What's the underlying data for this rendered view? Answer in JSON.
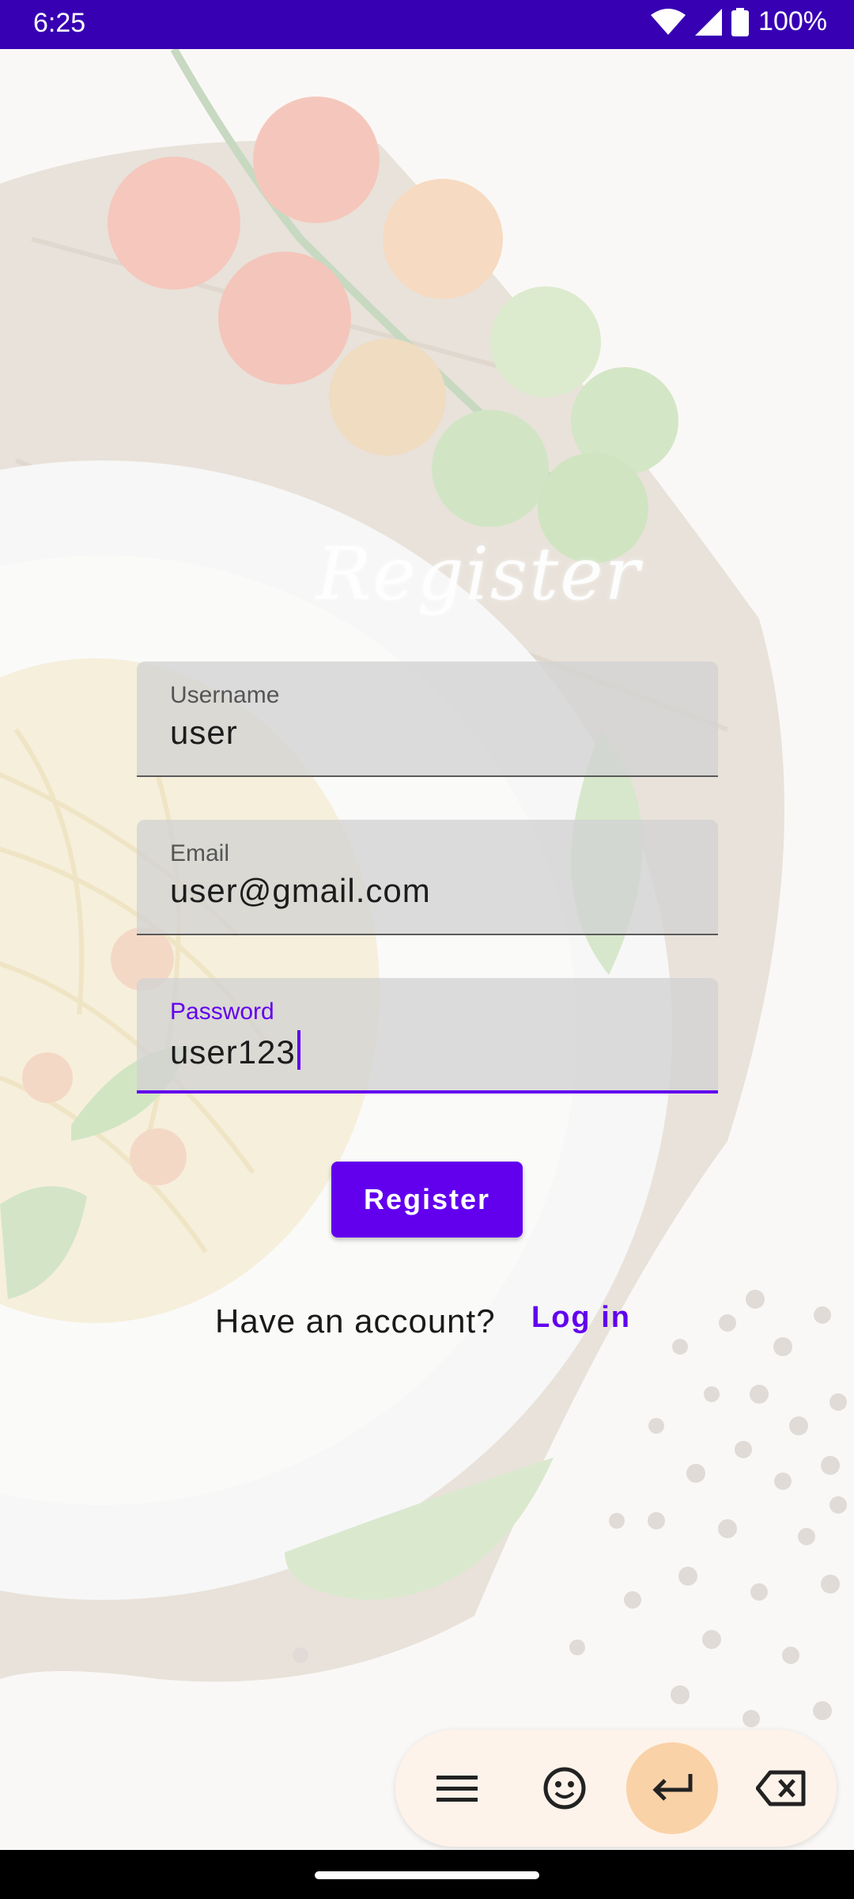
{
  "status_bar": {
    "time": "6:25",
    "battery": "100%",
    "icons": [
      "wifi-icon",
      "signal-icon",
      "battery-icon"
    ]
  },
  "screen": {
    "title": "Register"
  },
  "form": {
    "username": {
      "label": "Username",
      "value": "user"
    },
    "email": {
      "label": "Email",
      "value": "user@gmail.com"
    },
    "password": {
      "label": "Password",
      "value": "user123"
    }
  },
  "register_button": {
    "label": "Register"
  },
  "login_prompt": {
    "text": "Have an account?",
    "link": "Log in"
  },
  "keyboard_toolbar": {
    "icons": [
      "menu-icon",
      "emoji-icon",
      "enter-icon",
      "backspace-icon"
    ]
  },
  "colors": {
    "primary": "#6200ee",
    "status_bar": "#3700b3",
    "field_bg": "#d2d2d2",
    "toolbar_bg": "#fdf3ea",
    "enter_key_bg": "#fad2a8"
  }
}
